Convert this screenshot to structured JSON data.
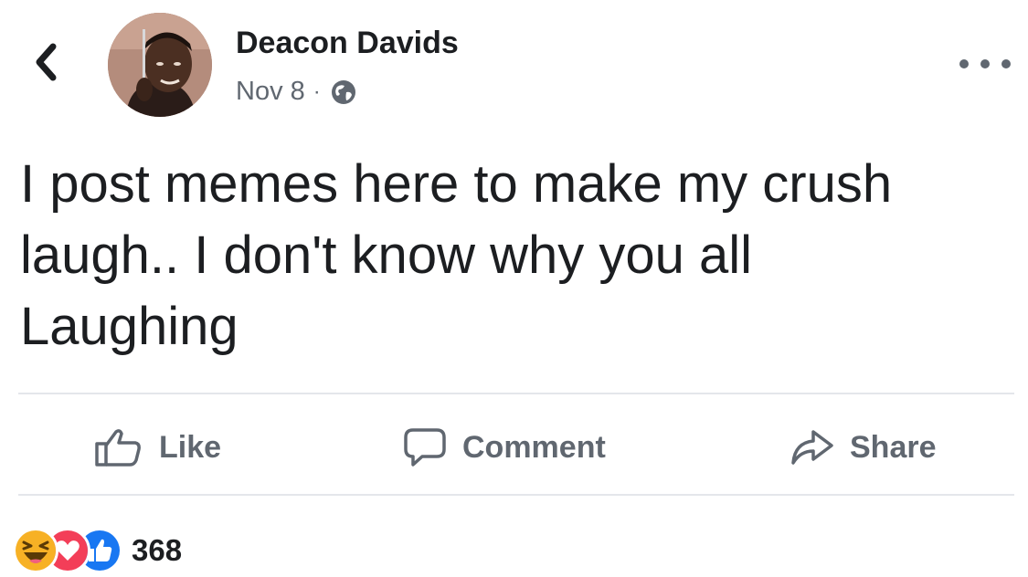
{
  "post": {
    "author": "Deacon Davids",
    "date": "Nov 8",
    "separator": "·",
    "audience_icon": "globe-icon",
    "text_lines": [
      "I post memes here to make my crush",
      "laugh.. I don't know why you all",
      "Laughing"
    ]
  },
  "actions": {
    "like_label": "Like",
    "comment_label": "Comment",
    "share_label": "Share"
  },
  "reactions": {
    "types": [
      "haha",
      "love",
      "like"
    ],
    "count": "368"
  },
  "colors": {
    "text": "#1c1e21",
    "secondary": "#606770",
    "divider": "#e4e6eb",
    "like_blue": "#1877f2",
    "love_red": "#f33e58",
    "haha_yellow": "#f7b125"
  }
}
